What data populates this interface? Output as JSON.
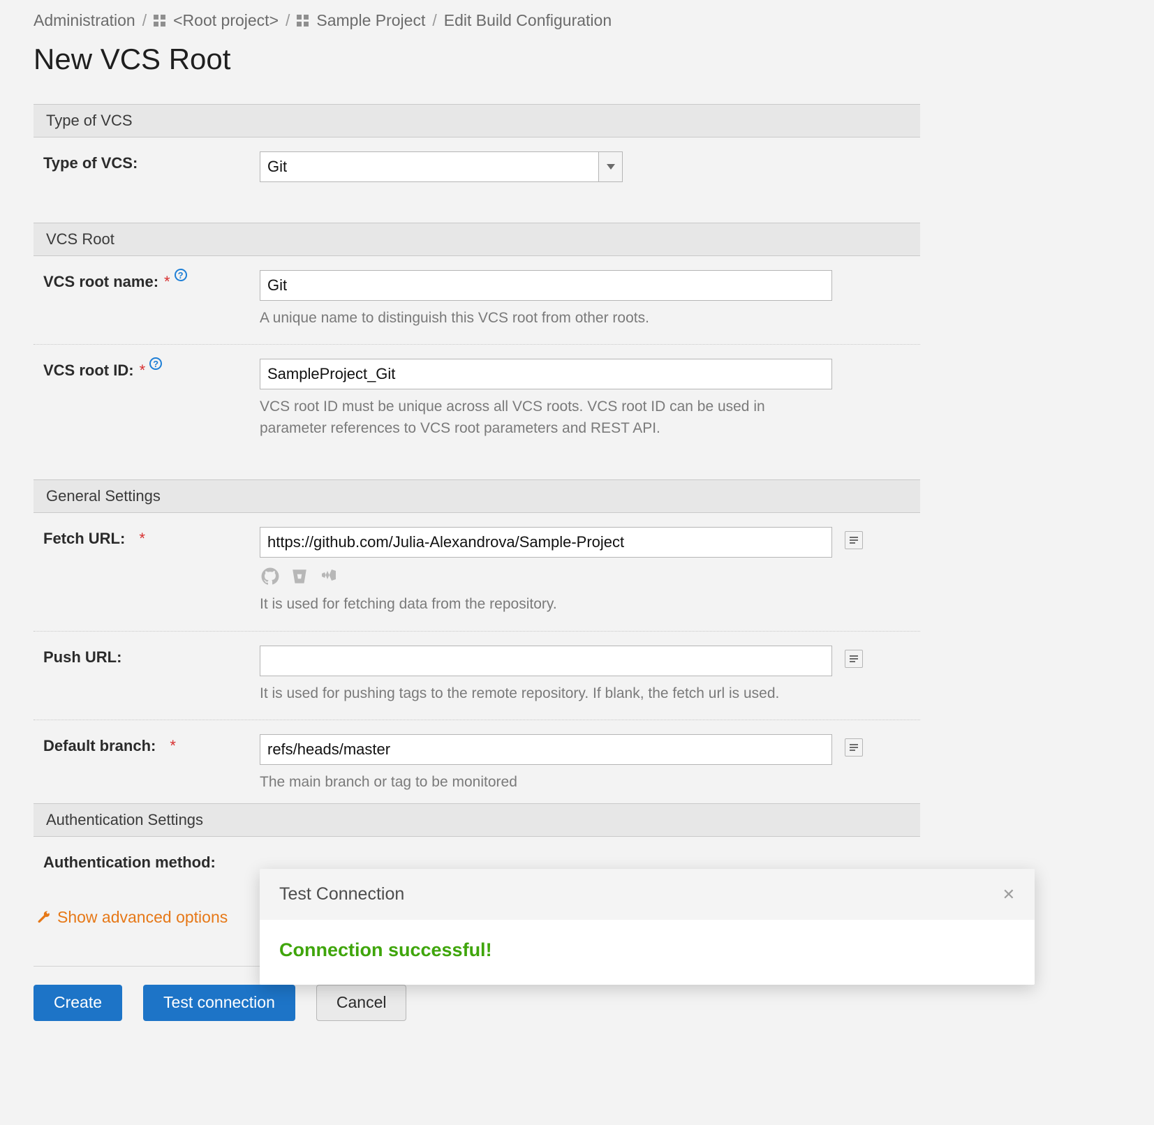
{
  "breadcrumb": {
    "admin": "Administration",
    "root": "<Root project>",
    "project": "Sample Project",
    "page": "Edit Build Configuration"
  },
  "title": "New VCS Root",
  "sections": {
    "type": {
      "header": "Type of VCS",
      "label": "Type of VCS:",
      "value": "Git"
    },
    "vcs_root": {
      "header": "VCS Root",
      "name_label": "VCS root name:",
      "name_value": "Git",
      "name_hint": "A unique name to distinguish this VCS root from other roots.",
      "id_label": "VCS root ID:",
      "id_value": "SampleProject_Git",
      "id_hint": "VCS root ID must be unique across all VCS roots. VCS root ID can be used in parameter references to VCS root parameters and REST API."
    },
    "general": {
      "header": "General Settings",
      "fetch_label": "Fetch URL:",
      "fetch_value": "https://github.com/Julia-Alexandrova/Sample-Project",
      "fetch_hint": "It is used for fetching data from the repository.",
      "push_label": "Push URL:",
      "push_value": "",
      "push_hint": "It is used for pushing tags to the remote repository. If blank, the fetch url is used.",
      "branch_label": "Default branch:",
      "branch_value": "refs/heads/master",
      "branch_hint": "The main branch or tag to be monitored"
    },
    "auth": {
      "header": "Authentication Settings",
      "method_label": "Authentication method:"
    }
  },
  "advanced_link": "Show advanced options",
  "buttons": {
    "create": "Create",
    "test": "Test connection",
    "cancel": "Cancel"
  },
  "dialog": {
    "title": "Test Connection",
    "message": "Connection successful!"
  }
}
